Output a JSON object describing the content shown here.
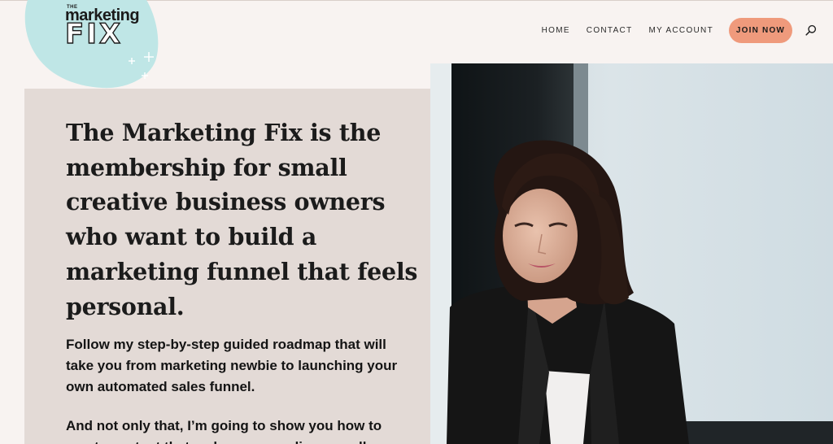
{
  "logo": {
    "the": "THE",
    "marketing": "marketing",
    "fix": "FIX",
    "alt": "The Marketing Fix logo",
    "blob_color": "#bfe6e6"
  },
  "nav": {
    "items": [
      {
        "label": "HOME"
      },
      {
        "label": "CONTACT"
      },
      {
        "label": "MY ACCOUNT"
      }
    ],
    "cta_label": "JOIN NOW",
    "cta_color": "#ef9a7c",
    "search_icon": "search-icon"
  },
  "hero": {
    "headline": "The Marketing Fix is the membership for small creative business owners who want to build a marketing funnel that feels personal.",
    "paragraph1": "Follow my step-by-step guided roadmap that will take you from marketing newbie to launching your own automated sales funnel.",
    "paragraph2": "And not only that, I’m going to show you how to create content that makes your audience really",
    "panel_color": "#e3dad6"
  },
  "photo": {
    "alt": "Portrait of a smiling woman with dark curly hair in a black blazer"
  }
}
